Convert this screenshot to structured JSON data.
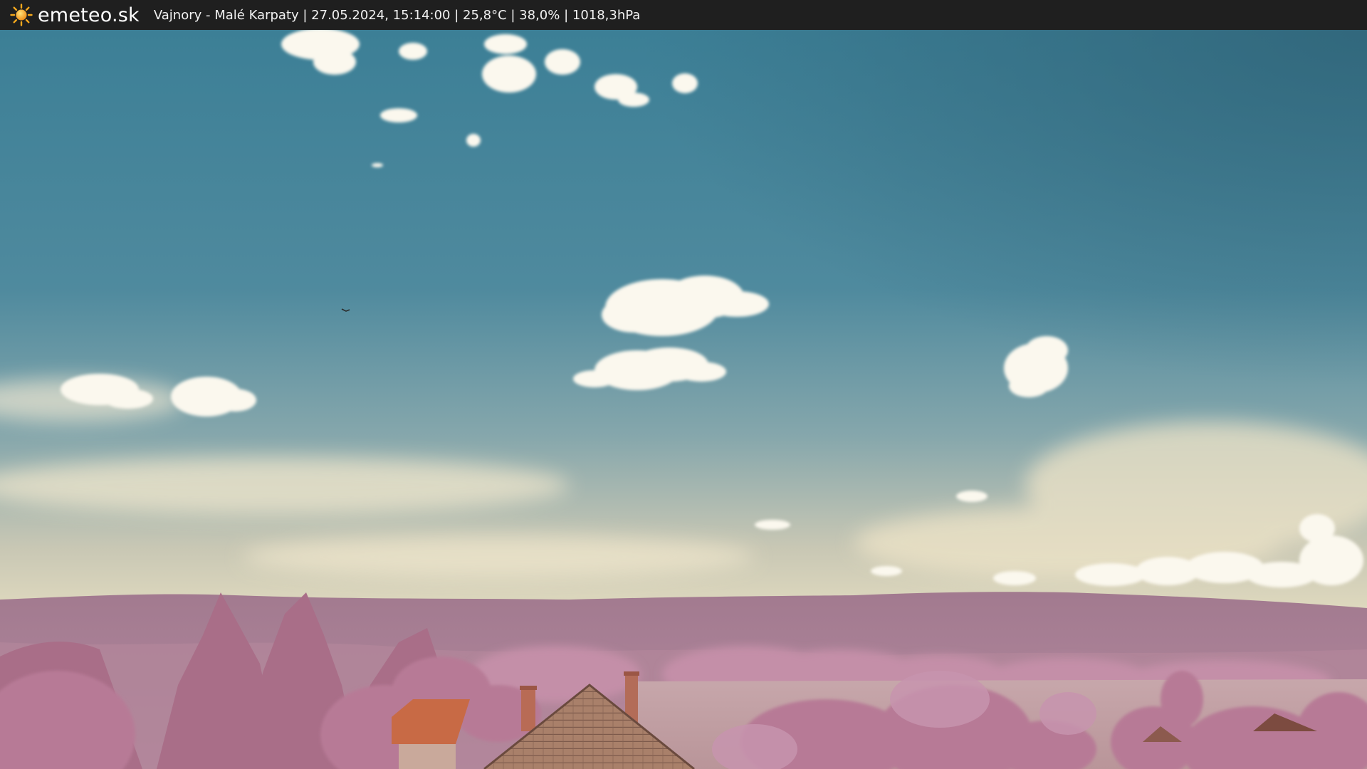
{
  "header": {
    "brand": "emeteo.sk",
    "logo_icon": "sun-icon",
    "caption": "Vajnory - Malé Karpaty | 27.05.2024, 15:14:00 | 25,8°C | 38,0% | 1018,3hPa"
  },
  "colors": {
    "bar_background": "#1f1f1f",
    "bar_text": "#ffffff",
    "sun": "#f4a81c",
    "sky_top": "#3f7e95",
    "sky_horizon": "#e6dcc0",
    "foliage": "#b57f98",
    "roof": "#c86a45"
  }
}
